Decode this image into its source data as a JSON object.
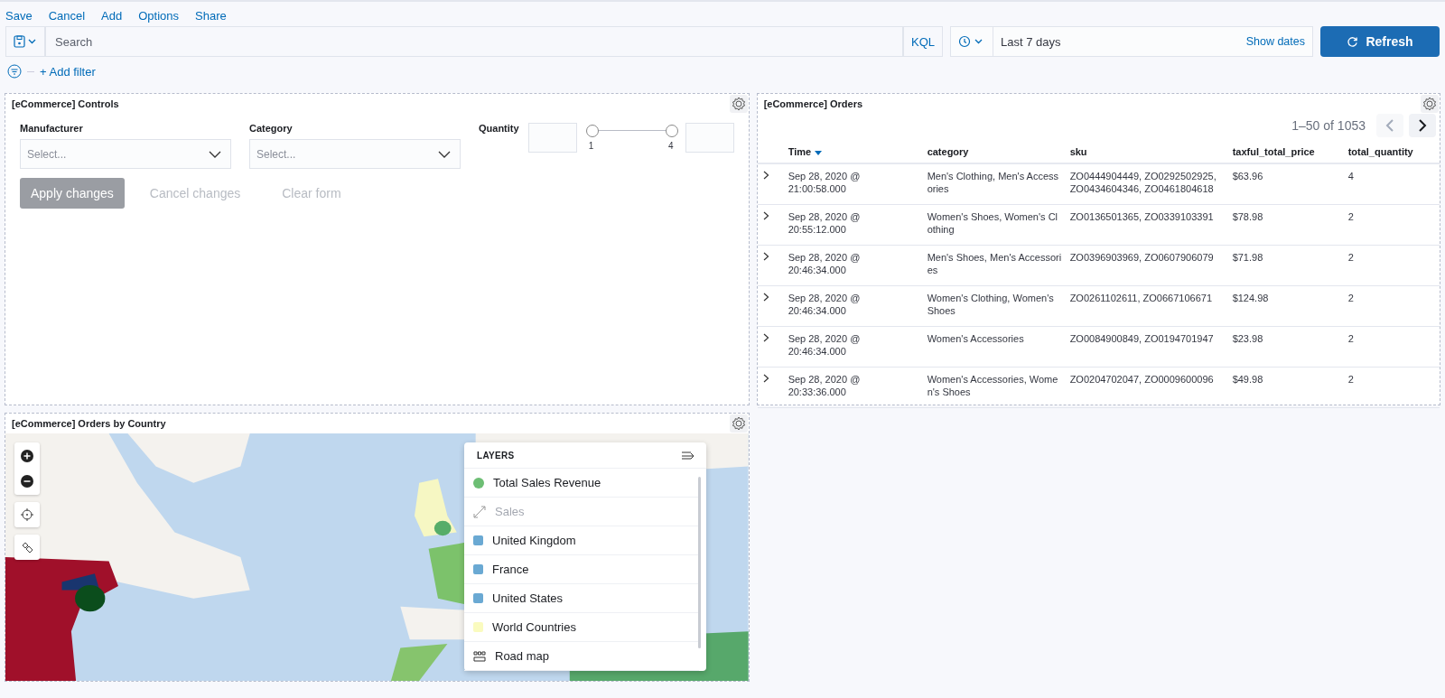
{
  "top_menu": [
    "Save",
    "Cancel",
    "Add",
    "Options",
    "Share"
  ],
  "query_bar": {
    "placeholder": "Search",
    "language": "KQL"
  },
  "time_picker": {
    "value": "Last 7 days",
    "show_dates": "Show dates",
    "refresh": "Refresh"
  },
  "filter_bar": {
    "add_filter": "+ Add filter"
  },
  "controls_panel": {
    "title": "[eCommerce] Controls",
    "fields": [
      {
        "kind": "select",
        "label": "Manufacturer",
        "placeholder": "Select..."
      },
      {
        "kind": "select",
        "label": "Category",
        "placeholder": "Select..."
      },
      {
        "kind": "range",
        "label": "Quantity",
        "min_label": "1",
        "max_label": "4",
        "thumbs": [
          {
            "level": 0
          },
          {
            "level": 1
          }
        ]
      }
    ],
    "buttons": [
      {
        "label": "Apply changes",
        "kind": "primary",
        "disabled": true
      },
      {
        "label": "Cancel changes",
        "kind": "empty",
        "disabled": true
      },
      {
        "label": "Clear form",
        "kind": "empty",
        "disabled": true
      }
    ]
  },
  "orders_panel": {
    "title": "[eCommerce] Orders",
    "pagination": "1–50 of 1053",
    "prev_disabled": true,
    "next_disabled": false,
    "columns": [
      "Time",
      "category",
      "sku",
      "taxful_total_price",
      "total_quantity"
    ],
    "rows": [
      {
        "expanded": false,
        "cells": [
          "Sep 28, 2020 @ 21:00:58.000",
          "Men's Clothing, Men's Accessories",
          "ZO0444904449, ZO0292502925, ZO0434604346, ZO0461804618",
          "$63.96",
          "4"
        ]
      },
      {
        "expanded": false,
        "cells": [
          "Sep 28, 2020 @ 20:55:12.000",
          "Women's Shoes, Women's Clothing",
          "ZO0136501365, ZO0339103391",
          "$78.98",
          "2"
        ]
      },
      {
        "expanded": false,
        "cells": [
          "Sep 28, 2020 @ 20:46:34.000",
          "Men's Shoes, Men's Accessories",
          "ZO0396903969, ZO0607906079",
          "$71.98",
          "2"
        ]
      },
      {
        "expanded": false,
        "cells": [
          "Sep 28, 2020 @ 20:46:34.000",
          "Women's Clothing, Women's Shoes",
          "ZO0261102611, ZO0667106671",
          "$124.98",
          "2"
        ]
      },
      {
        "expanded": false,
        "cells": [
          "Sep 28, 2020 @ 20:46:34.000",
          "Women's Accessories",
          "ZO0084900849, ZO0194701947",
          "$23.98",
          "2"
        ]
      },
      {
        "expanded": false,
        "cells": [
          "Sep 28, 2020 @ 20:33:36.000",
          "Women's Accessories, Women's Shoes",
          "ZO0204702047, ZO0009600096",
          "$49.98",
          "2"
        ]
      }
    ]
  },
  "map_panel": {
    "title": "[eCommerce] Orders by Country",
    "layers_title": "LAYERS",
    "layers": [
      {
        "kind": "dot",
        "name": "Total Sales Revenue",
        "color": "#6dbe74",
        "disabled": false
      },
      {
        "kind": "line",
        "name": "Sales",
        "disabled": true
      },
      {
        "kind": "square",
        "name": "United Kingdom",
        "color": "#6aa9d3",
        "disabled": false
      },
      {
        "kind": "square",
        "name": "France",
        "color": "#6aa9d3",
        "disabled": false
      },
      {
        "kind": "square",
        "name": "United States",
        "color": "#6aa9d3",
        "disabled": false
      },
      {
        "kind": "square",
        "name": "World Countries",
        "color": "#fafbbf",
        "disabled": false
      },
      {
        "kind": "grid",
        "name": "Road map",
        "disabled": false
      }
    ]
  }
}
